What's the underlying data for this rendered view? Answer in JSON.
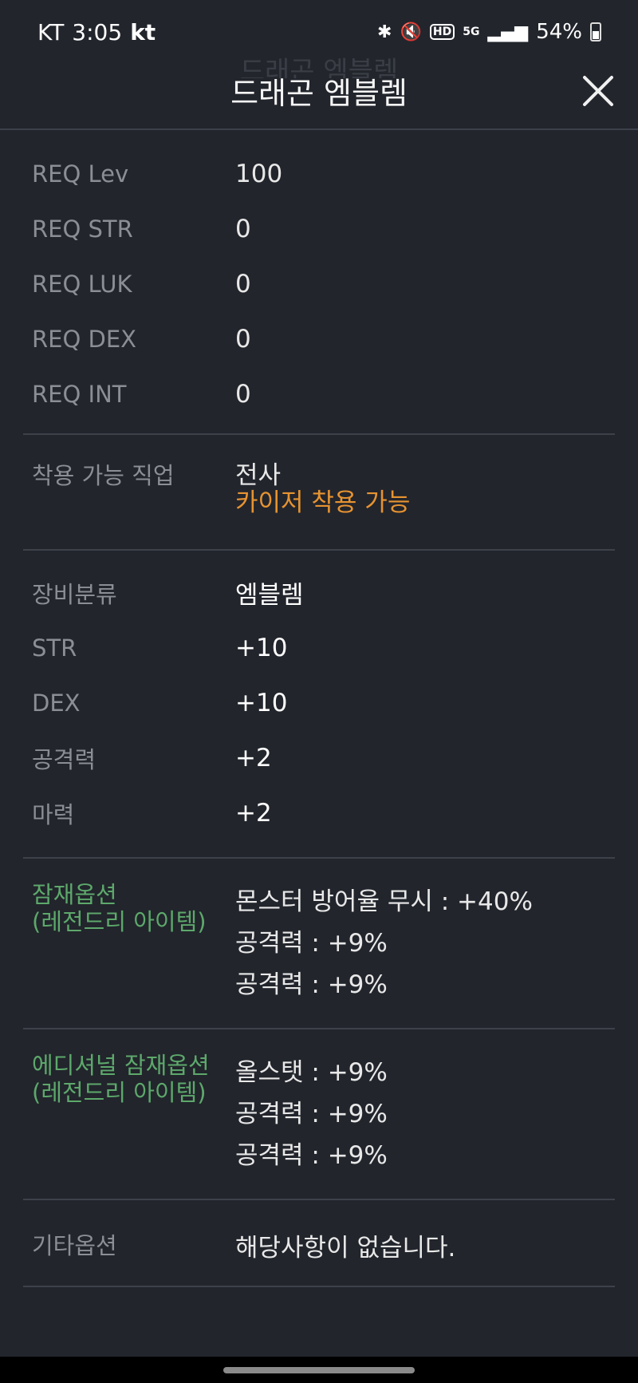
{
  "status": {
    "carrier": "KT",
    "time": "3:05",
    "carrier2": "kt",
    "battery_pct": "54%",
    "icons": [
      "bluetooth-icon",
      "mute-icon",
      "hd-icon",
      "5g-icon",
      "signal-icon",
      "battery-icon"
    ],
    "hd_text": "HD",
    "net_text": "5G"
  },
  "header": {
    "ghost_title": "드래곤 엠블렘",
    "title": "드래곤 엠블렘"
  },
  "requirements": [
    {
      "label": "REQ Lev",
      "value": "100"
    },
    {
      "label": "REQ STR",
      "value": "0"
    },
    {
      "label": "REQ LUK",
      "value": "0"
    },
    {
      "label": "REQ DEX",
      "value": "0"
    },
    {
      "label": "REQ INT",
      "value": "0"
    }
  ],
  "job": {
    "label": "착용 가능 직업",
    "value": "전사",
    "note": "카이저 착용 가능"
  },
  "stats": [
    {
      "label": "장비분류",
      "value": "엠블렘"
    },
    {
      "label": "STR",
      "value": "+10"
    },
    {
      "label": "DEX",
      "value": "+10"
    },
    {
      "label": "공격력",
      "value": "+2"
    },
    {
      "label": "마력",
      "value": "+2"
    }
  ],
  "potential": {
    "label1": "잠재옵션",
    "label2": "(레전드리 아이템)",
    "lines": [
      "몬스터 방어율 무시 : +40%",
      "공격력 : +9%",
      "공격력 : +9%"
    ]
  },
  "additional": {
    "label1": "에디셔널 잠재옵션",
    "label2": "(레전드리 아이템)",
    "lines": [
      "올스탯 : +9%",
      "공격력 : +9%",
      "공격력 : +9%"
    ]
  },
  "etc": {
    "label": "기타옵션",
    "value": "해당사항이 없습니다."
  },
  "colors": {
    "background": "#22252c",
    "potential_label": "#5da86b",
    "job_note": "#e79331"
  }
}
